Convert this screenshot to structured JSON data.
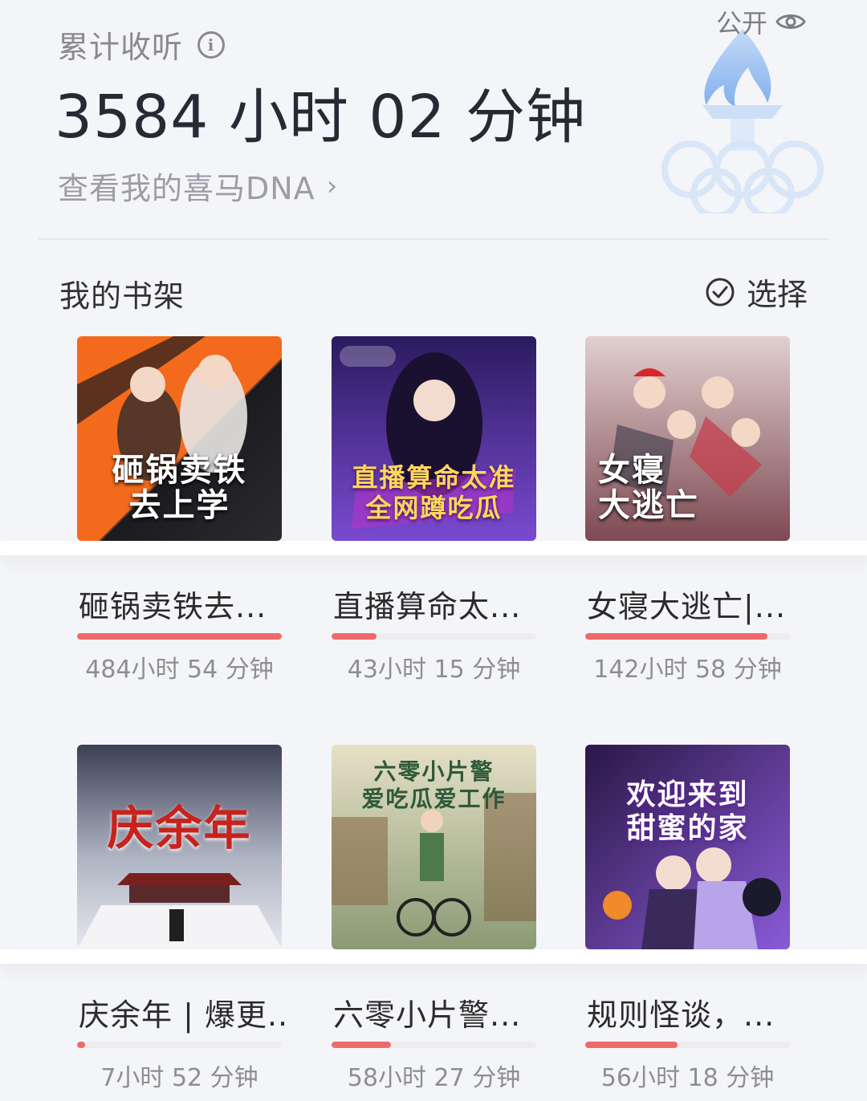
{
  "summary": {
    "label": "累计收听",
    "value": "3584 小时 02 分钟",
    "dna_link": "查看我的喜马DNA",
    "public_label": "公开"
  },
  "shelf": {
    "title": "我的书架",
    "select_label": "选择",
    "books": [
      {
        "title": "砸锅卖铁去...",
        "time": "484小时 54 分钟",
        "progress": 1.0
      },
      {
        "title": "直播算命太...",
        "time": "43小时 15 分钟",
        "progress": 0.22
      },
      {
        "title": "女寝大逃亡|...",
        "time": "142小时 58 分钟",
        "progress": 0.89
      },
      {
        "title": "庆余年 | 爆更...",
        "time": "7小时 52 分钟",
        "progress": 0.04
      },
      {
        "title": "六零小片警...",
        "time": "58小时 27 分钟",
        "progress": 0.29
      },
      {
        "title": "规则怪谈，...",
        "time": "56小时 18 分钟",
        "progress": 0.45
      }
    ],
    "covers": [
      {
        "text": "砸锅卖铁\n去上学",
        "bg1": "#f36a1d",
        "bg2": "#1b1b1f",
        "color": "#ffffff"
      },
      {
        "text": "直播算命太准\n全网蹲吃瓜",
        "bg1": "#2a1b5e",
        "bg2": "#7a4ad0",
        "color": "#ffd75a"
      },
      {
        "text": "女寝\n大逃亡",
        "bg1": "#d9c4c4",
        "bg2": "#6a3f46",
        "color": "#ffffff"
      },
      {
        "text": "庆余年",
        "bg1": "#3c3f55",
        "bg2": "#c9cdd8",
        "color": "#c8221c"
      },
      {
        "text": "六零小片警\n爱吃瓜爱工作",
        "bg1": "#d7d0b0",
        "bg2": "#7b8f6a",
        "color": "#2e5a3a"
      },
      {
        "text": "欢迎来到\n甜蜜的家",
        "bg1": "#2a1846",
        "bg2": "#8a5ad8",
        "color": "#ffffff"
      }
    ]
  }
}
